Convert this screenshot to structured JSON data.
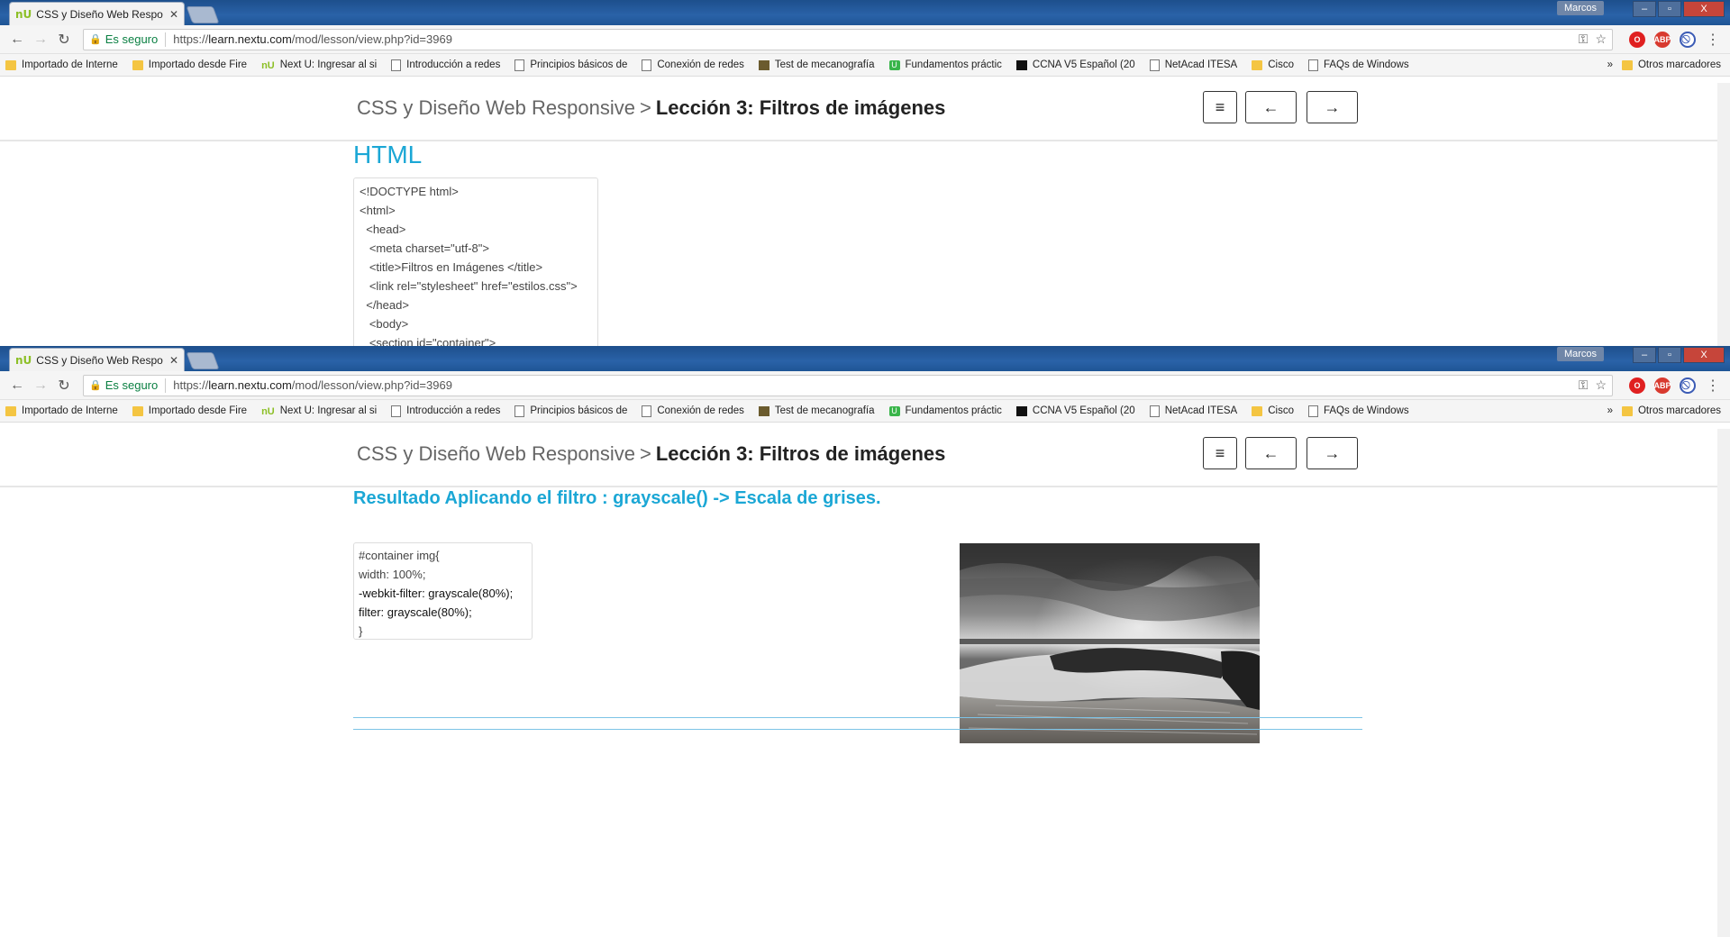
{
  "browser": {
    "tab_title": "CSS y Diseño Web Respo",
    "tab_favicon": "nU",
    "user": "Marcos",
    "window_buttons": [
      "–",
      "▫",
      "X"
    ],
    "secure_label": "Es seguro",
    "url_scheme": "https://",
    "url_host": "learn.nextu.com",
    "url_path": "/mod/lesson/view.php?id=3969",
    "bookmarks": [
      {
        "label": "Importado de Interne",
        "icon": "folder-icon"
      },
      {
        "label": "Importado desde Fire",
        "icon": "folder-icon"
      },
      {
        "label": "Next U: Ingresar al si",
        "icon": "nextu-icon"
      },
      {
        "label": "Introducción a redes",
        "icon": "page-icon"
      },
      {
        "label": "Principios básicos de",
        "icon": "page-icon"
      },
      {
        "label": "Conexión de redes",
        "icon": "page-icon"
      },
      {
        "label": "Test de mecanografía",
        "icon": "typing-icon"
      },
      {
        "label": "Fundamentos práctic",
        "icon": "udemy-icon"
      },
      {
        "label": "CCNA V5 Español (20",
        "icon": "ccna-icon"
      },
      {
        "label": "NetAcad ITESA",
        "icon": "page-icon"
      },
      {
        "label": "Cisco",
        "icon": "folder-icon"
      },
      {
        "label": "FAQs de Windows",
        "icon": "page-icon"
      }
    ],
    "overflow": "»",
    "other_bookmarks": "Otros marcadores"
  },
  "header": {
    "course": "CSS y Diseño Web Responsive",
    "separator": ">",
    "lesson": "Lección 3: Filtros de imágenes",
    "menu_glyph": "≡",
    "prev_glyph": "←",
    "next_glyph": "→"
  },
  "top": {
    "heading": "HTML",
    "code_lines": [
      "<!DOCTYPE html>",
      "<html>",
      "  <head>",
      "   <meta charset=\"utf-8\">",
      "   <title>Filtros en Imágenes </title>",
      "   <link rel=\"stylesheet\" href=\"estilos.css\">",
      "  </head>",
      "   <body>",
      "   <section id=\"container\">"
    ]
  },
  "bottom": {
    "heading": "Resultado Aplicando el filtro : grayscale() -> Escala de grises.",
    "code_lines": [
      "#container img{",
      "width: 100%;",
      "-webkit-filter: grayscale(80%);",
      "filter: grayscale(80%);",
      "}"
    ]
  }
}
